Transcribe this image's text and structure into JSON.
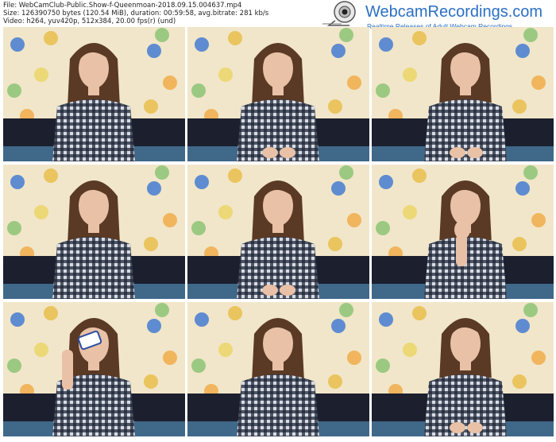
{
  "file_info": {
    "line1": "File: WebCamClub-Public.Show-f-Queenmoan-2018.09.15.004637.mp4",
    "line2": "Size: 126390750 bytes (120.54 MiB), duration: 00:59:58, avg.bitrate: 281 kb/s",
    "line3": "Video: h264, yuv420p, 512x384, 20.00 fps(r) (und)"
  },
  "logo": {
    "name": "WebcamRecordings.com",
    "tagline": "Realtime Releases of Adult Webcam Recordings"
  },
  "thumbnails": [
    {
      "id": "frame-1",
      "pose": "hair-down"
    },
    {
      "id": "frame-2",
      "pose": "looking-down"
    },
    {
      "id": "frame-3",
      "pose": "looking-down"
    },
    {
      "id": "frame-4",
      "pose": "hair-down"
    },
    {
      "id": "frame-5",
      "pose": "looking-down"
    },
    {
      "id": "frame-6",
      "pose": "hand-chin"
    },
    {
      "id": "frame-7",
      "pose": "drinking"
    },
    {
      "id": "frame-8",
      "pose": "mouth-open"
    },
    {
      "id": "frame-9",
      "pose": "hands-together"
    }
  ],
  "colors": {
    "wall": "#f1e6c9",
    "shirt_dark": "#1f2638",
    "shirt_light": "#d7dbe4",
    "hair": "#5a3a25",
    "skin": "#e9c1a6",
    "sofa": "#1b1f2e",
    "accent": "#2a6fc4"
  }
}
